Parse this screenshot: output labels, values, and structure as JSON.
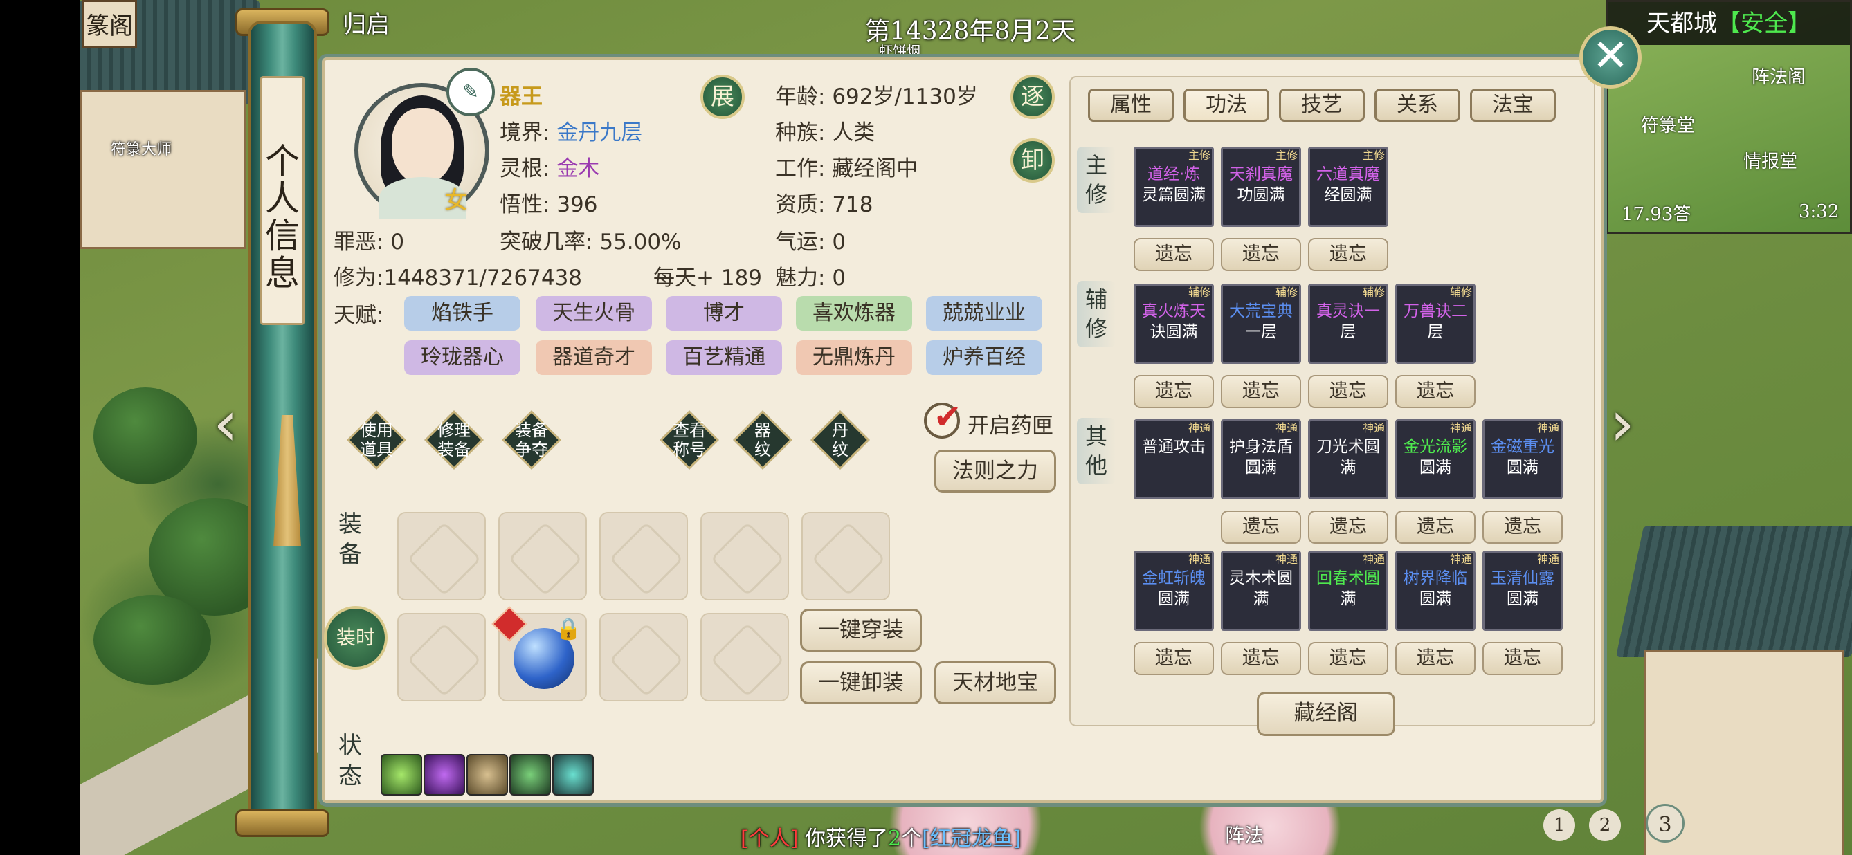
{
  "hud": {
    "back_label": "归启",
    "date": "第14328年8月2天",
    "sub_date": "虾饼烟",
    "top_left_sign": "篆阁",
    "npc_name": "符箓大师"
  },
  "minimap": {
    "city": "天都城",
    "safety": "【安全】",
    "labels": [
      "阵法阁",
      "符箓堂",
      "情报堂"
    ],
    "left_value": "17.93",
    "left_suffix": "答",
    "time": "3:32"
  },
  "scroll": {
    "title": "个人信息"
  },
  "profile": {
    "name": "器王",
    "gender": "女",
    "realm_label": "境界:",
    "realm": "金丹九层",
    "root_label": "灵根:",
    "root": "金木",
    "wisdom_label": "悟性:",
    "wisdom": "396",
    "sin_label": "罪恶:",
    "sin": "0",
    "breakthrough_label": "突破几率:",
    "breakthrough": "55.00%",
    "cultivation_label": "修为:",
    "cultivation": "1448371/7267438",
    "daily_label": "每天+",
    "daily": "189",
    "age_label": "年龄:",
    "age": "692岁/1130岁",
    "race_label": "种族:",
    "race": "人类",
    "job_label": "工作:",
    "job": "藏经阁中",
    "aptitude_label": "资质:",
    "aptitude": "718",
    "luck_label": "气运:",
    "luck": "0",
    "charm_label": "魅力:",
    "charm": "0",
    "talent_label": "天赋:",
    "expand_btn": "展",
    "expel_btn": "逐",
    "unload_btn": "卸"
  },
  "talents": [
    {
      "label": "焰铁手",
      "color": "blue"
    },
    {
      "label": "天生火骨",
      "color": "purple"
    },
    {
      "label": "博才",
      "color": "purple"
    },
    {
      "label": "喜欢炼器",
      "color": "green"
    },
    {
      "label": "兢兢业业",
      "color": "blue"
    },
    {
      "label": "玲珑器心",
      "color": "purple"
    },
    {
      "label": "器道奇才",
      "color": "orange"
    },
    {
      "label": "百艺精通",
      "color": "purple"
    },
    {
      "label": "无鼎炼丹",
      "color": "orange"
    },
    {
      "label": "炉养百经",
      "color": "blue"
    }
  ],
  "actions": {
    "use_item": "使用道具",
    "repair": "修理装备",
    "equip_contest": "装备争夺",
    "view_title": "查看称号",
    "artifact_pattern": "器纹",
    "pill_pattern": "丹纹",
    "open_pill_box": "开启药匣",
    "law_power": "法则之力",
    "equip_all": "一键穿装",
    "unequip_all": "一键卸装",
    "treasure": "天材地宝"
  },
  "sections": {
    "equip": "装备",
    "fashion": "装时",
    "status": "状态"
  },
  "tabs": [
    "属性",
    "功法",
    "技艺",
    "关系",
    "法宝"
  ],
  "right_sections": {
    "main": "主修",
    "aux": "辅修",
    "other": "其他"
  },
  "forget_label": "遗忘",
  "library_button": "藏经阁",
  "skills": {
    "main": [
      {
        "kind": "主修",
        "line1": "道经·炼",
        "line2": "灵篇圆满",
        "color": "purple"
      },
      {
        "kind": "主修",
        "line1": "天刹真魔",
        "line2": "功圆满",
        "color": "purple"
      },
      {
        "kind": "主修",
        "line1": "六道真魔",
        "line2": "经圆满",
        "color": "purple"
      }
    ],
    "aux": [
      {
        "kind": "辅修",
        "line1": "真火炼天",
        "line2": "诀圆满",
        "color": "purple"
      },
      {
        "kind": "辅修",
        "line1": "大荒宝典",
        "line2": "一层",
        "color": "blue"
      },
      {
        "kind": "辅修",
        "line1": "真灵诀一",
        "line2": "层",
        "color": "purple"
      },
      {
        "kind": "辅修",
        "line1": "万兽诀二",
        "line2": "层",
        "color": "purple"
      }
    ],
    "other1": [
      {
        "kind": "神通",
        "line1": "普通攻击",
        "line2": "",
        "color": "white"
      },
      {
        "kind": "神通",
        "line1": "护身法盾",
        "line2": "圆满",
        "color": "white"
      },
      {
        "kind": "神通",
        "line1": "刀光术圆",
        "line2": "满",
        "color": "white"
      },
      {
        "kind": "神通",
        "line1": "金光流影",
        "line2": "圆满",
        "color": "green"
      },
      {
        "kind": "神通",
        "line1": "金磁重光",
        "line2": "圆满",
        "color": "blue"
      }
    ],
    "other2": [
      {
        "kind": "神通",
        "line1": "金虹斩魄",
        "line2": "圆满",
        "color": "blue"
      },
      {
        "kind": "神通",
        "line1": "灵木术圆",
        "line2": "满",
        "color": "white"
      },
      {
        "kind": "神通",
        "line1": "回春术圆",
        "line2": "满",
        "color": "green"
      },
      {
        "kind": "神通",
        "line1": "树界降临",
        "line2": "圆满",
        "color": "blue"
      },
      {
        "kind": "神通",
        "line1": "玉清仙露",
        "line2": "圆满",
        "color": "blue"
      }
    ]
  },
  "message": {
    "channel": "[个人]",
    "text1": "你获得了",
    "count": "2",
    "unit": "个",
    "item": "[红冠龙鱼]"
  },
  "bottom_nav": {
    "pages": [
      "1",
      "2",
      "3"
    ],
    "formation": "阵法"
  }
}
